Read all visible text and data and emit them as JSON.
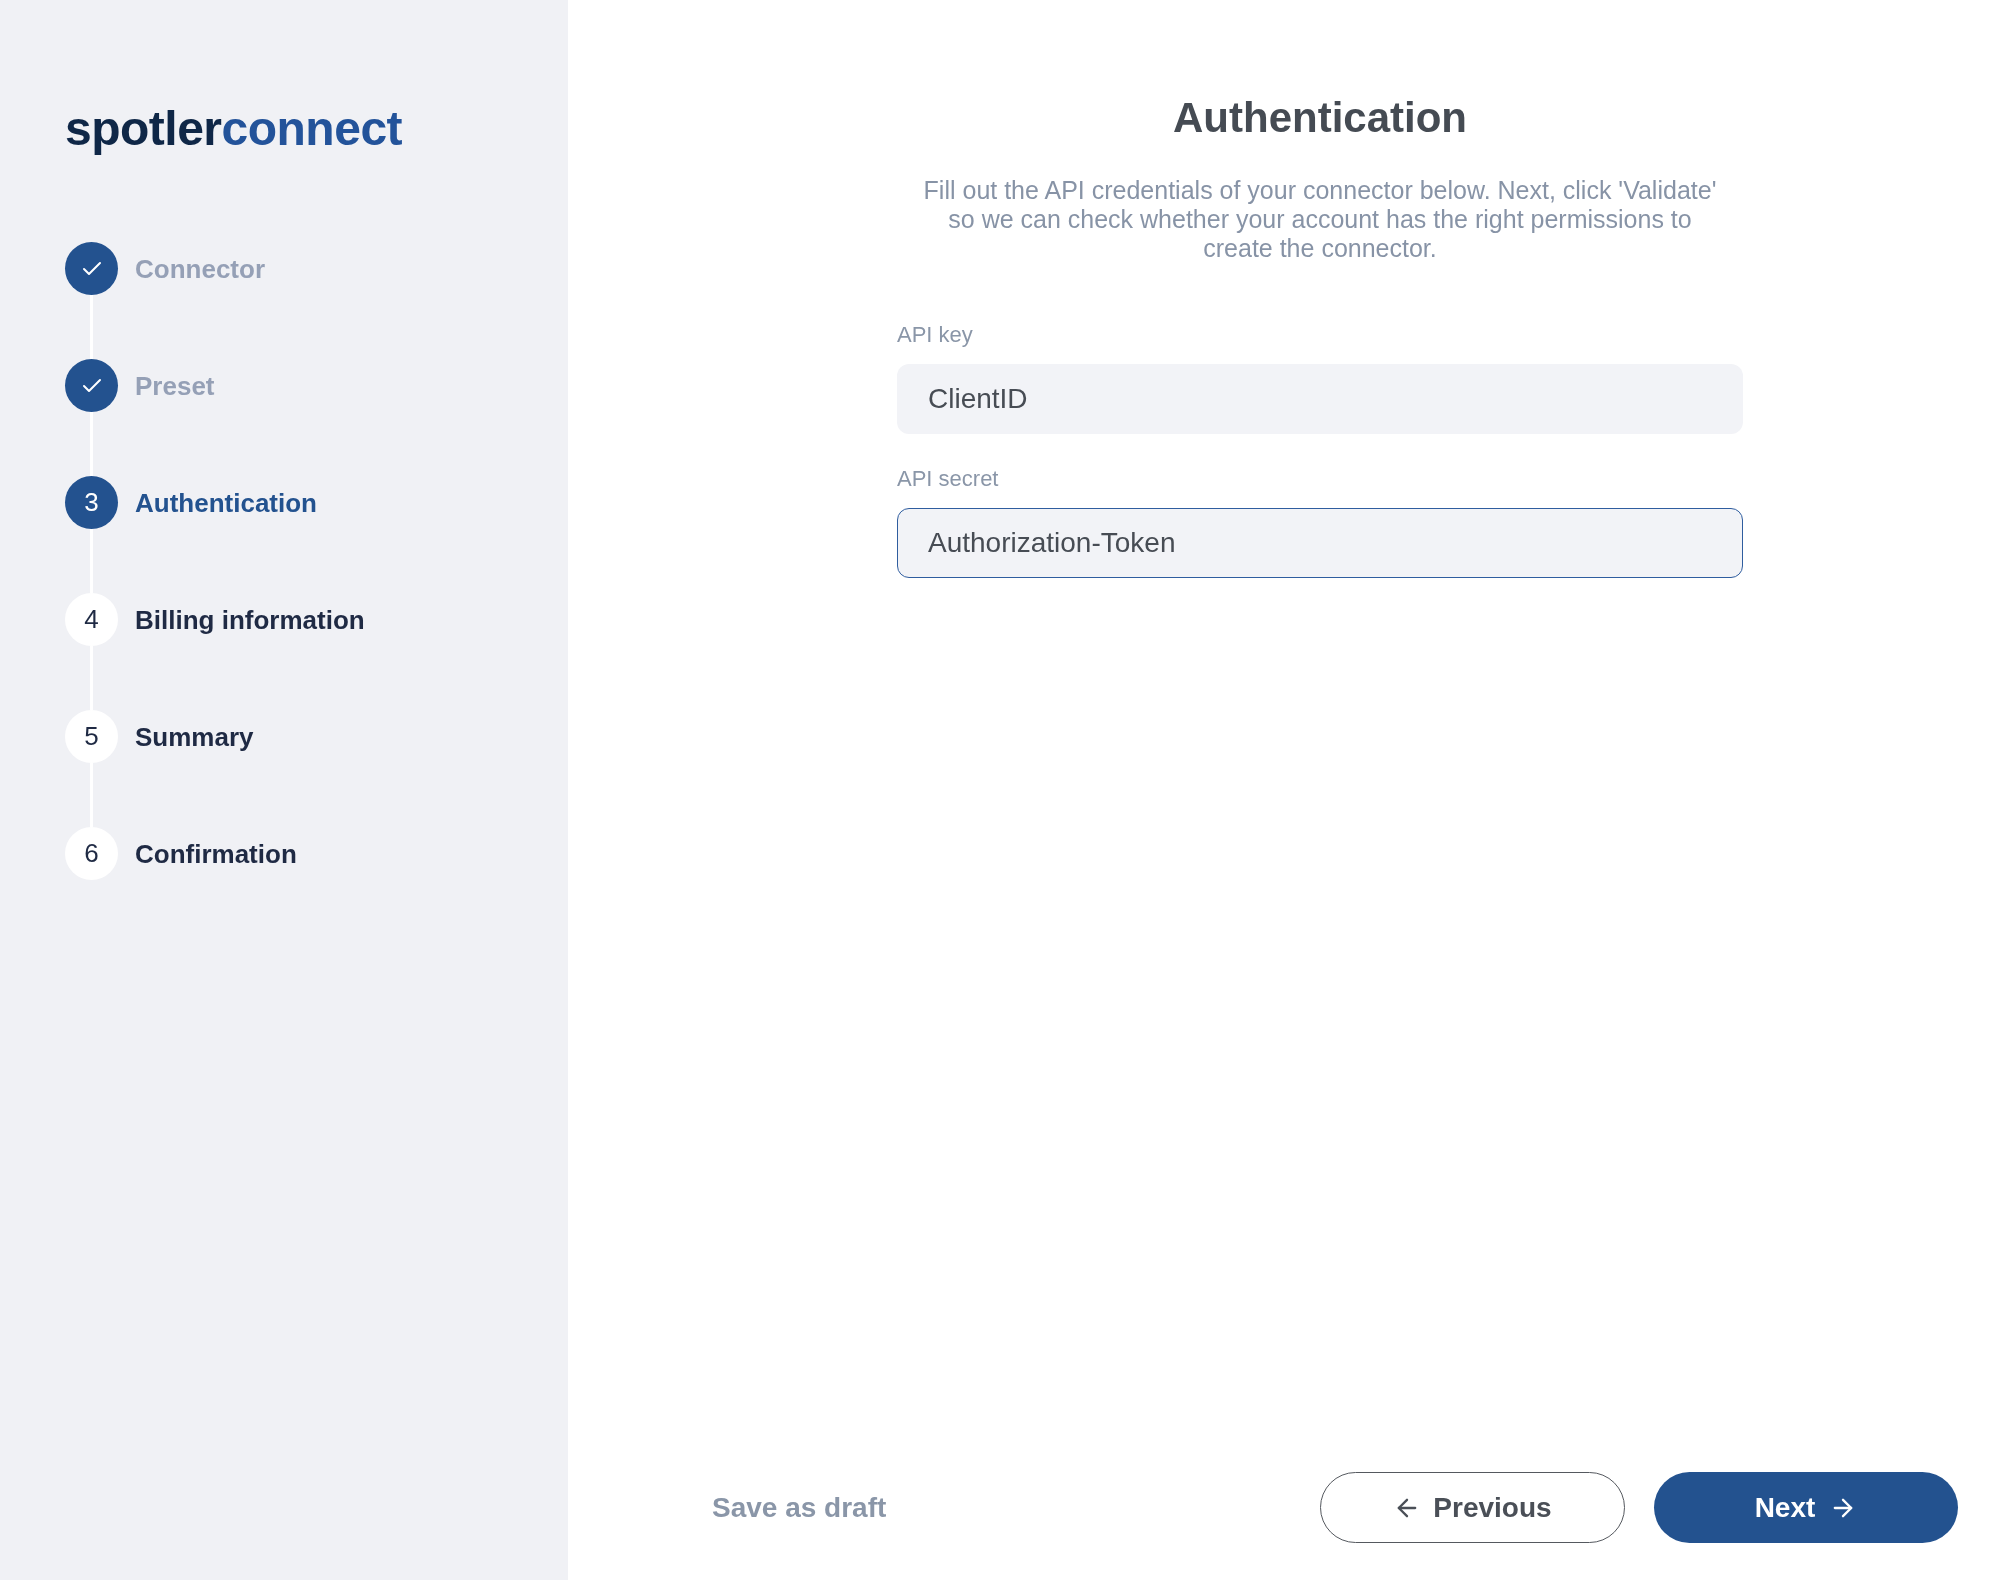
{
  "sidebar": {
    "logo": {
      "parts": [
        "spotler",
        "connect"
      ]
    },
    "steps": [
      {
        "label": "Connector",
        "completed": true,
        "selected": false
      },
      {
        "label": "Preset",
        "completed": true,
        "selected": false
      },
      {
        "number": "3",
        "label": "Authentication",
        "completed": false,
        "selected": true
      },
      {
        "number": "4",
        "label": "Billing information",
        "completed": false,
        "selected": false
      },
      {
        "number": "5",
        "label": "Summary",
        "completed": false,
        "selected": false
      },
      {
        "number": "6",
        "label": "Confirmation",
        "completed": false,
        "selected": false
      }
    ]
  },
  "main": {
    "title": "Authentication",
    "description": "Fill out the API credentials of your connector below. Next, click 'Validate' so we can check whether your account has the right permissions to create the connector.",
    "fields": [
      {
        "label": "API key",
        "value": "ClientID",
        "focused": false
      },
      {
        "label": "API secret",
        "value": "Authorization-Token",
        "focused": true
      }
    ]
  },
  "footer": {
    "save_draft": "Save as draft",
    "previous": "Previous",
    "next": "Next"
  }
}
